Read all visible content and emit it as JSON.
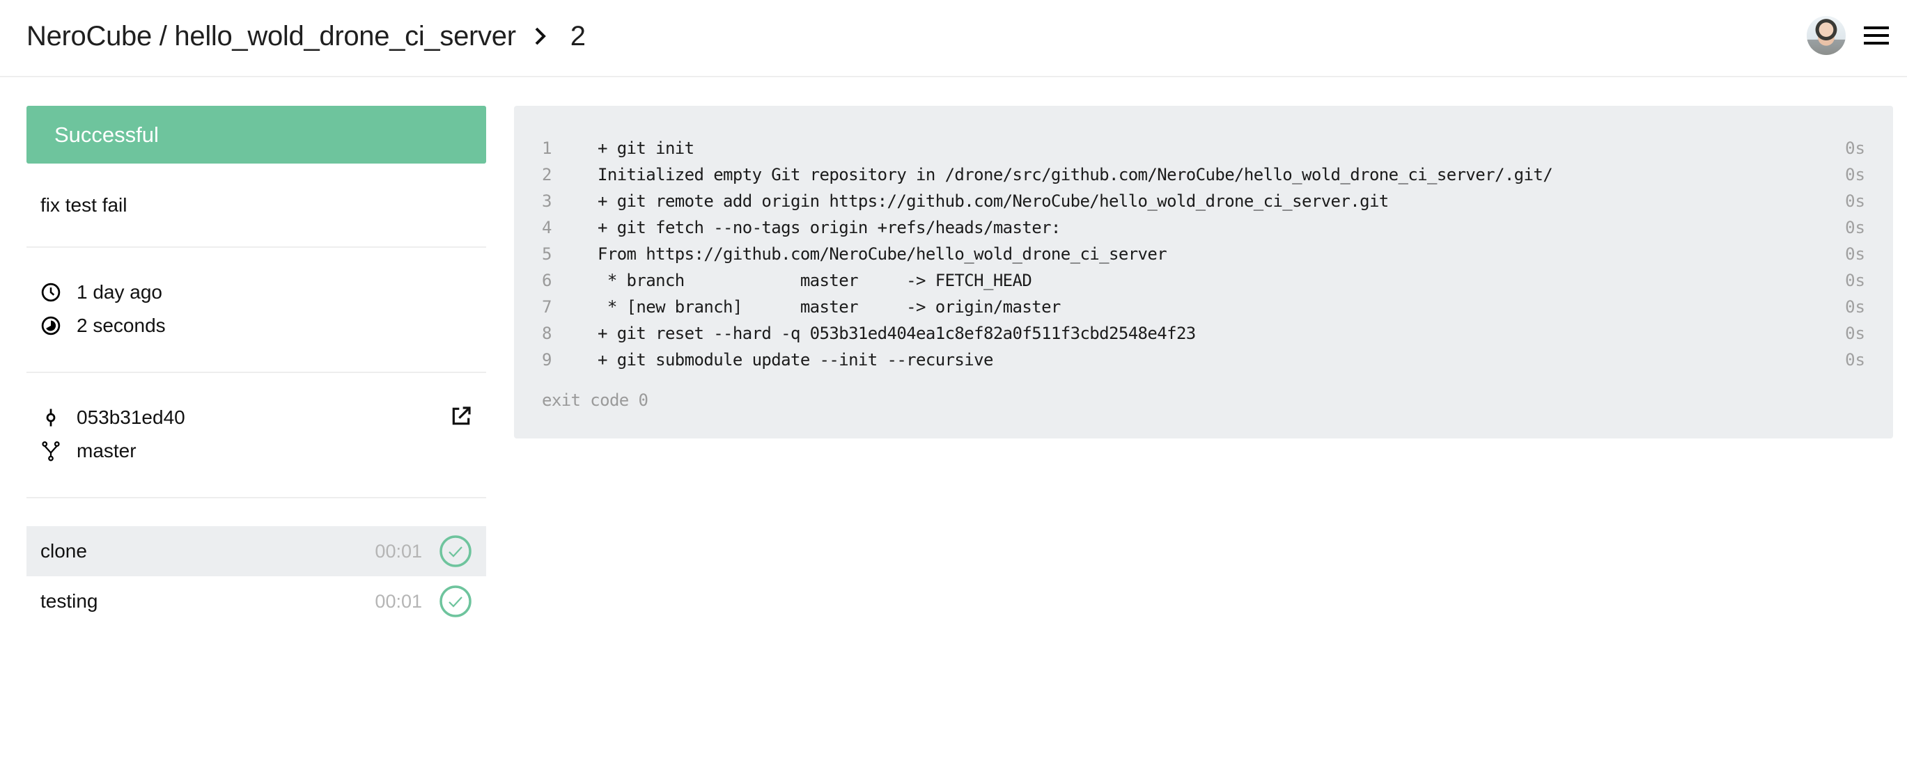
{
  "header": {
    "owner": "NeroCube",
    "separator": "/",
    "repo": "hello_wold_drone_ci_server",
    "build_number": "2",
    "icons": {
      "chevron": "chevron-right-icon",
      "avatar": "user-avatar",
      "menu": "hamburger-menu-icon"
    }
  },
  "build": {
    "status": "Successful",
    "status_color": "#6ec49d",
    "message": "fix test fail",
    "started": "1 day ago",
    "duration": "2 seconds",
    "commit": "053b31ed40",
    "branch": "master"
  },
  "stages": [
    {
      "name": "clone",
      "duration": "00:01",
      "status": "success",
      "active": true
    },
    {
      "name": "testing",
      "duration": "00:01",
      "status": "success",
      "active": false
    }
  ],
  "log": {
    "lines": [
      {
        "num": "1",
        "text": "+ git init",
        "time": "0s"
      },
      {
        "num": "2",
        "text": "Initialized empty Git repository in /drone/src/github.com/NeroCube/hello_wold_drone_ci_server/.git/",
        "time": "0s"
      },
      {
        "num": "3",
        "text": "+ git remote add origin https://github.com/NeroCube/hello_wold_drone_ci_server.git",
        "time": "0s"
      },
      {
        "num": "4",
        "text": "+ git fetch --no-tags origin +refs/heads/master:",
        "time": "0s"
      },
      {
        "num": "5",
        "text": "From https://github.com/NeroCube/hello_wold_drone_ci_server",
        "time": "0s"
      },
      {
        "num": "6",
        "text": " * branch            master     -> FETCH_HEAD",
        "time": "0s"
      },
      {
        "num": "7",
        "text": " * [new branch]      master     -> origin/master",
        "time": "0s"
      },
      {
        "num": "8",
        "text": "+ git reset --hard -q 053b31ed404ea1c8ef82a0f511f3cbd2548e4f23",
        "time": "0s"
      },
      {
        "num": "9",
        "text": "+ git submodule update --init --recursive",
        "time": "0s"
      }
    ],
    "exit_code": "exit code 0"
  }
}
